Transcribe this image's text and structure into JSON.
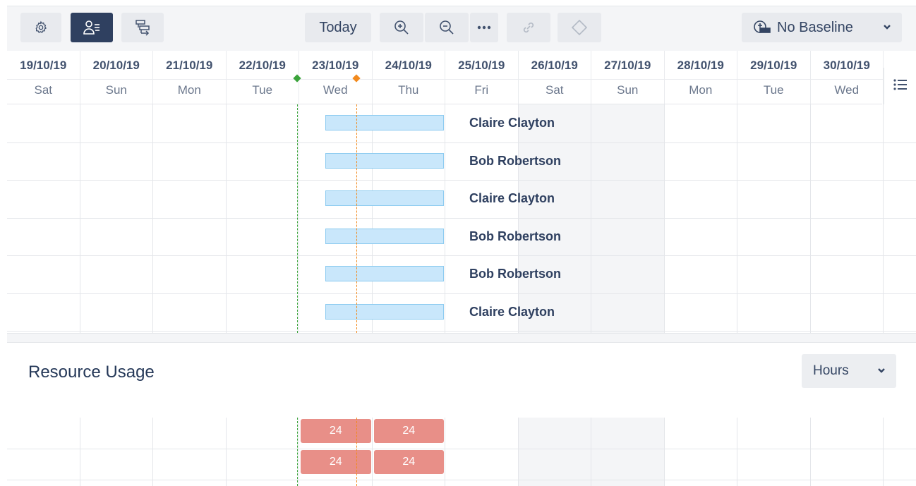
{
  "toolbar": {
    "today_label": "Today",
    "baseline_label": "No Baseline",
    "icons": [
      "gear-icon",
      "resource-view-icon",
      "gantt-view-icon",
      "zoom-in-icon",
      "zoom-out-icon",
      "more-icon",
      "link-icon",
      "milestone-icon",
      "baseline-icon",
      "chevron-down-icon"
    ]
  },
  "timeline": {
    "columns": [
      {
        "date": "19/10/19",
        "day": "Sat",
        "weekend": false
      },
      {
        "date": "20/10/19",
        "day": "Sun",
        "weekend": false
      },
      {
        "date": "21/10/19",
        "day": "Mon",
        "weekend": false
      },
      {
        "date": "22/10/19",
        "day": "Tue",
        "weekend": false
      },
      {
        "date": "23/10/19",
        "day": "Wed",
        "weekend": false
      },
      {
        "date": "24/10/19",
        "day": "Thu",
        "weekend": false
      },
      {
        "date": "25/10/19",
        "day": "Fri",
        "weekend": false
      },
      {
        "date": "26/10/19",
        "day": "Sat",
        "weekend": true
      },
      {
        "date": "27/10/19",
        "day": "Sun",
        "weekend": true
      },
      {
        "date": "28/10/19",
        "day": "Mon",
        "weekend": false
      },
      {
        "date": "29/10/19",
        "day": "Tue",
        "weekend": false
      },
      {
        "date": "30/10/19",
        "day": "Wed",
        "weekend": false
      }
    ]
  },
  "tasks": [
    {
      "assignee": "Claire Clayton"
    },
    {
      "assignee": "Bob Robertson"
    },
    {
      "assignee": "Claire Clayton"
    },
    {
      "assignee": "Bob Robertson"
    },
    {
      "assignee": "Bob Robertson"
    },
    {
      "assignee": "Claire Clayton"
    }
  ],
  "resource_usage": {
    "title": "Resource Usage",
    "unit": "Hours",
    "rows": [
      [
        "24",
        "24"
      ],
      [
        "24",
        "24"
      ]
    ]
  },
  "colors": {
    "active_button": "#2f4060",
    "task_bar": "#c9e7fb",
    "today_line": "#3aa33a",
    "status_line": "#f28a1d",
    "overallocation": "#e88f88"
  }
}
